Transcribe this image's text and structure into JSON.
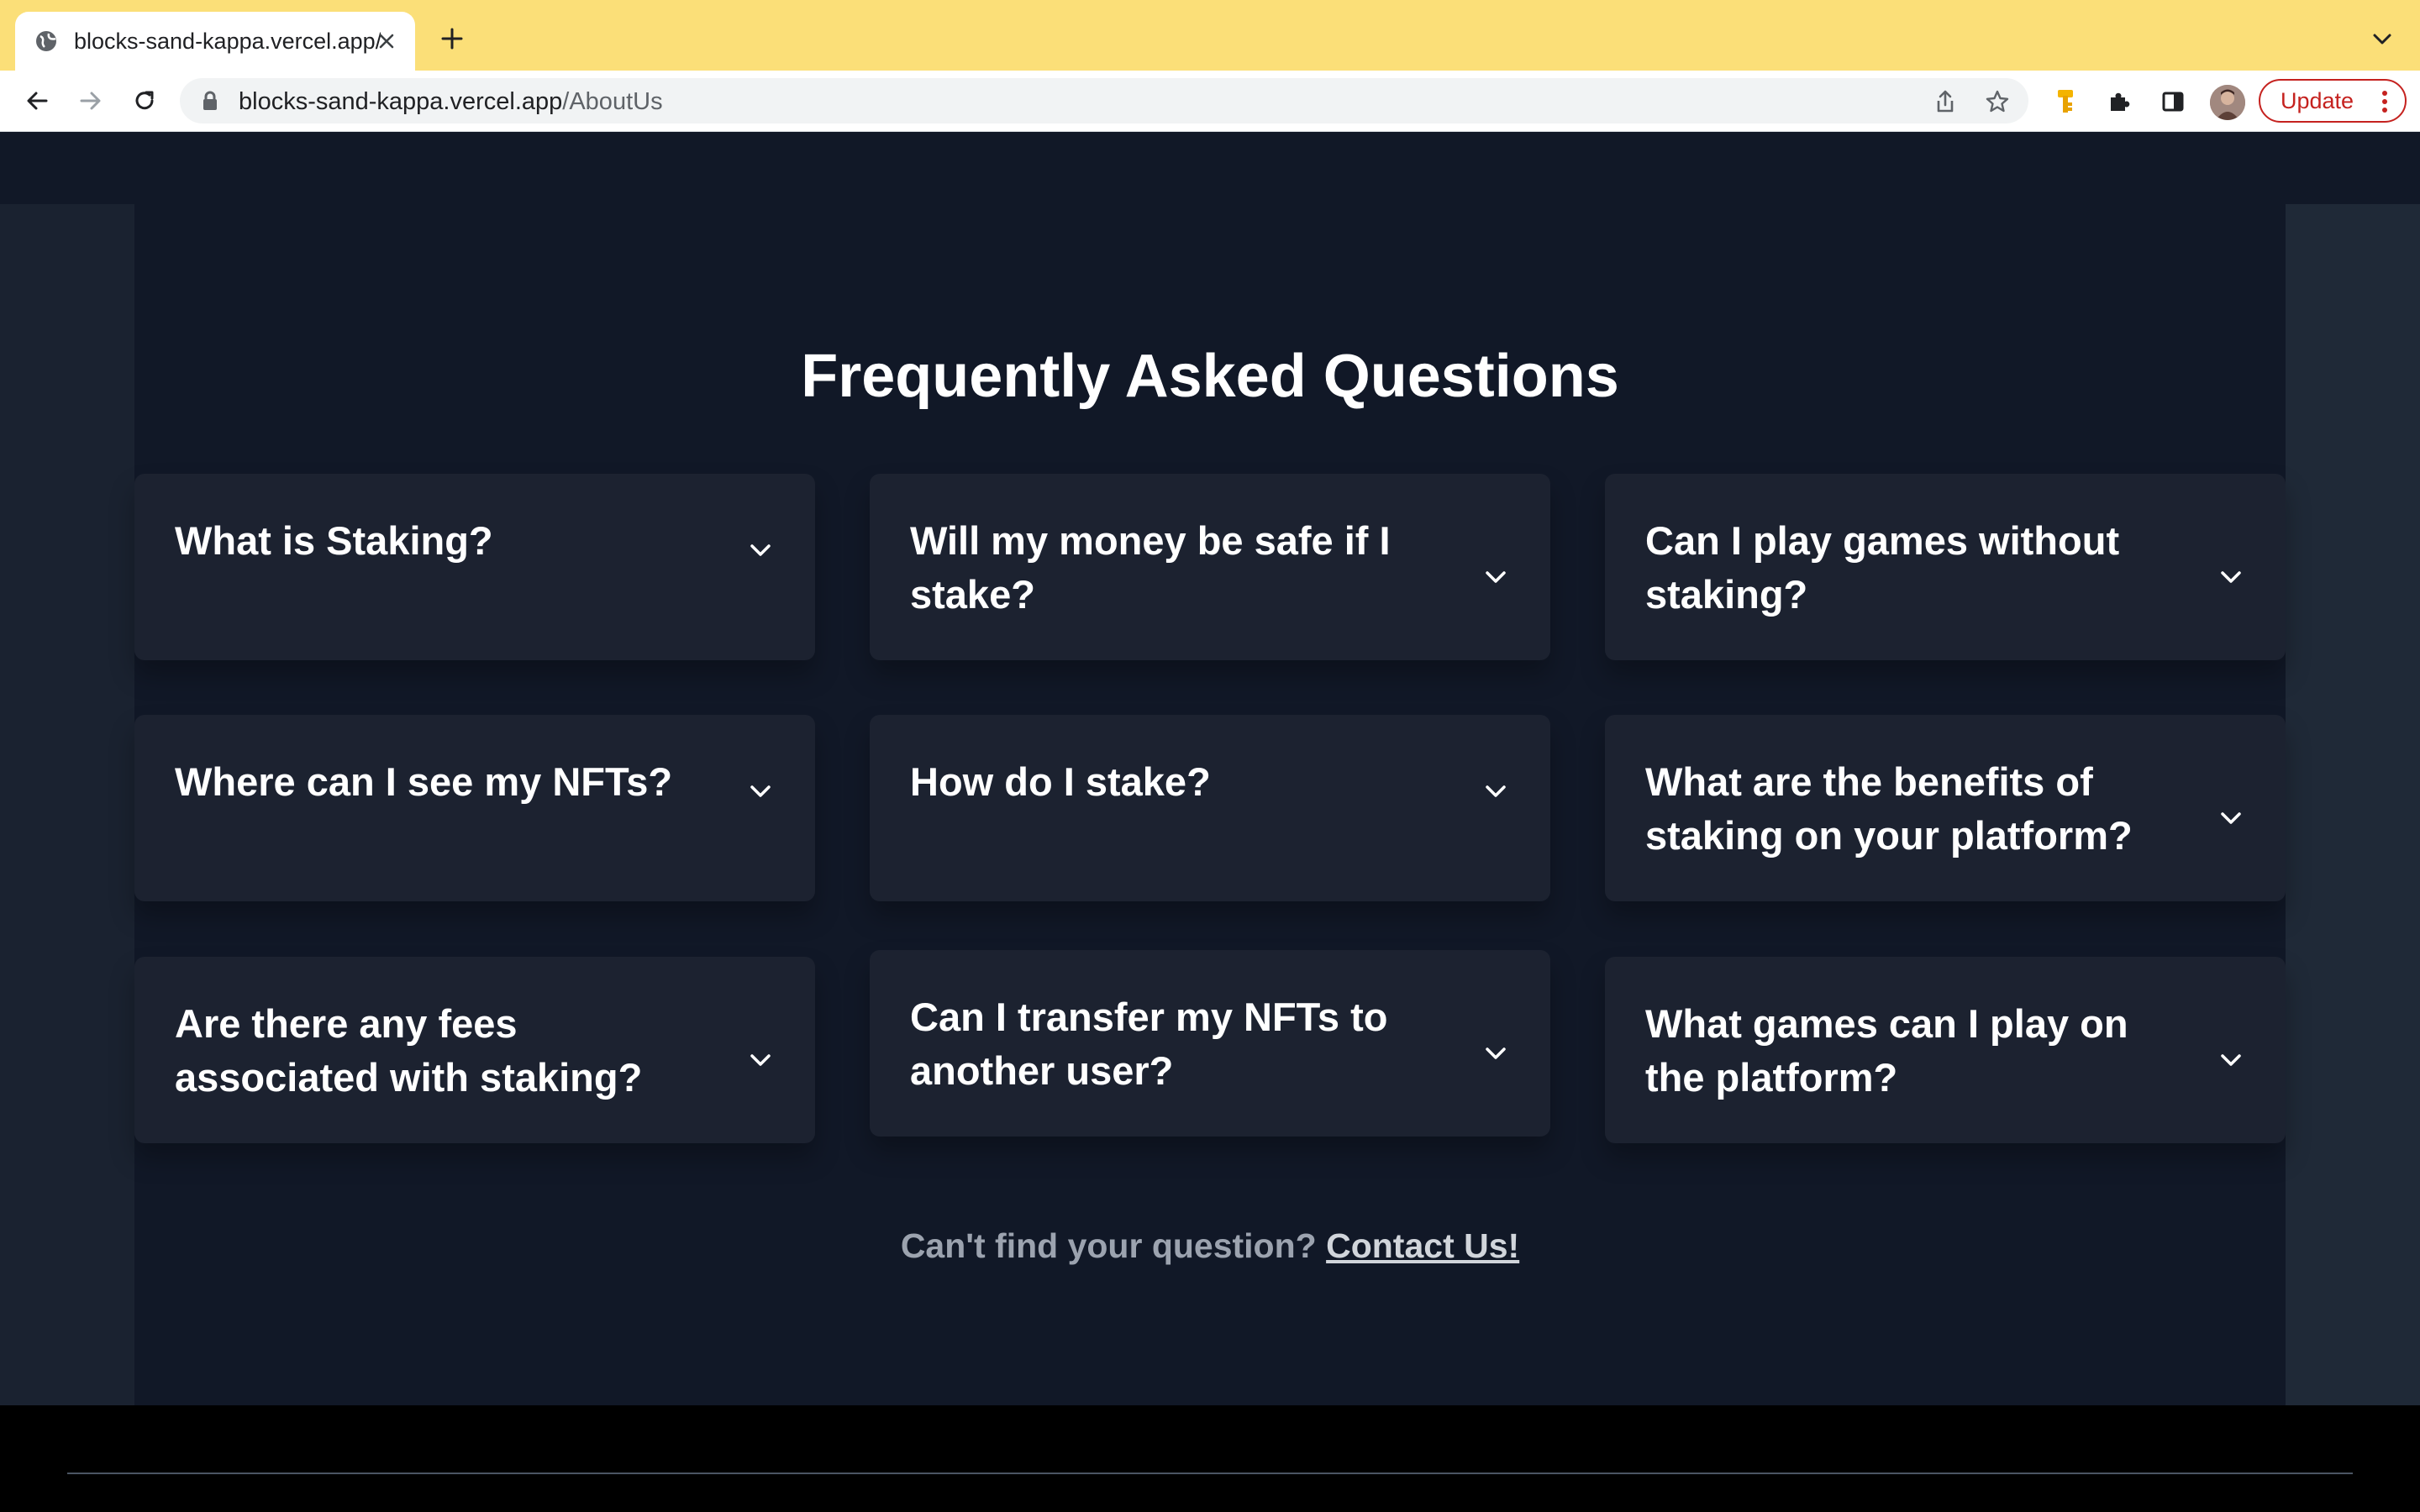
{
  "browser": {
    "tab_title": "blocks-sand-kappa.vercel.app/AboutUs",
    "url_host": "blocks-sand-kappa.vercel.app",
    "url_path": "/AboutUs",
    "update_label": "Update",
    "tabstrip_color": "#fbdf78",
    "update_color": "#c5221f"
  },
  "faq": {
    "title": "Frequently Asked Questions",
    "items": [
      {
        "question": "What is Staking?",
        "icon": "chevron-down-icon"
      },
      {
        "question": "Will my money be safe if I stake?",
        "icon": "chevron-down-icon"
      },
      {
        "question": "Can I play games without staking?",
        "icon": "chevron-down-icon"
      },
      {
        "question": "Where can I see my NFTs?",
        "icon": "chevron-down-icon"
      },
      {
        "question": "How do I stake?",
        "icon": "chevron-down-icon"
      },
      {
        "question": "What are the benefits of staking on your platform?",
        "icon": "chevron-down-icon"
      },
      {
        "question": "Are there any fees associated with staking?",
        "icon": "chevron-down-icon"
      },
      {
        "question": "Can I transfer my NFTs to another user?",
        "icon": "chevron-down-icon"
      },
      {
        "question": "What games can I play on the platform?",
        "icon": "chevron-down-icon"
      }
    ],
    "contact_prefix": "Can't find your question?",
    "contact_link": "Contact Us!"
  },
  "colors": {
    "page_background": "#111827",
    "card_background": "#1c2230",
    "footer_background": "#000000"
  }
}
